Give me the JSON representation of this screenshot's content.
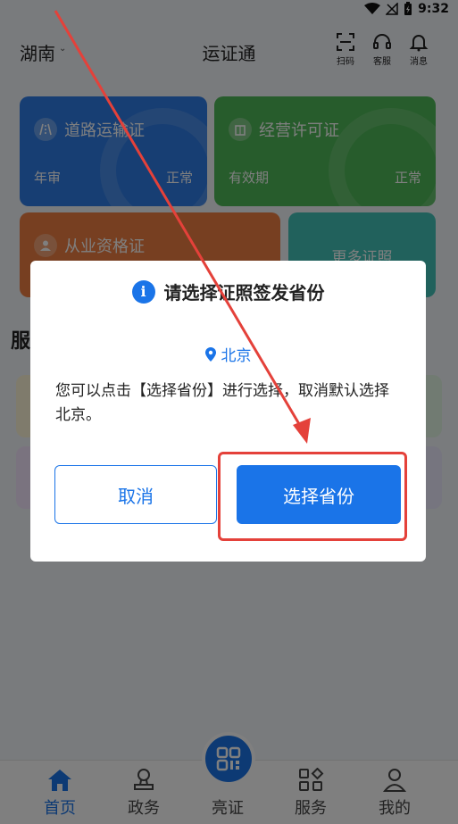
{
  "status_bar": {
    "time": "9:32"
  },
  "header": {
    "region": "湖南",
    "title": "运证通",
    "scan_label": "扫码",
    "service_label": "客服",
    "message_label": "消息"
  },
  "cards": [
    {
      "title": "道路运输证",
      "left": "年审",
      "right": "正常"
    },
    {
      "title": "经营许可证",
      "left": "有效期",
      "right": "正常"
    },
    {
      "title": "从业资格证",
      "left": "",
      "right": ""
    },
    {
      "title": "更多证照",
      "left": "",
      "right": ""
    }
  ],
  "section_title": "服",
  "bottom_nav": [
    {
      "label": "首页",
      "active": true
    },
    {
      "label": "政务",
      "active": false
    },
    {
      "label": "亮证",
      "active": false
    },
    {
      "label": "服务",
      "active": false
    },
    {
      "label": "我的",
      "active": false
    }
  ],
  "dialog": {
    "title": "请选择证照签发省份",
    "location": "北京",
    "body": "您可以点击【选择省份】进行选择，取消默认选择北京。",
    "cancel_label": "取消",
    "confirm_label": "选择省份"
  },
  "colors": {
    "primary": "#1a74e8",
    "annotation": "#e4413a",
    "card_road": "#2f7de6",
    "card_biz": "#4fb858",
    "card_prof": "#ee7f43",
    "card_more": "#43c3b9"
  }
}
